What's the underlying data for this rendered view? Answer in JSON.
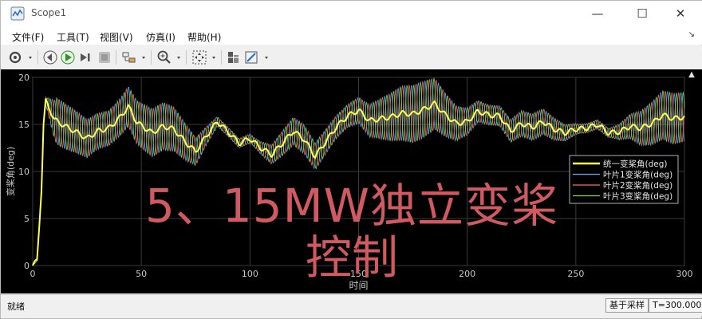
{
  "window": {
    "title": "Scope1"
  },
  "menu": [
    "文件(F)",
    "工具(T)",
    "视图(V)",
    "仿真(I)",
    "帮助(H)"
  ],
  "toolbar_icons": [
    "settings-icon",
    "step-back-icon",
    "run-icon",
    "step-forward-icon",
    "stop-icon",
    "highlight-block-icon",
    "zoom-icon",
    "fit-to-view-icon",
    "cursor-measure-icon",
    "style-edit-icon"
  ],
  "status": {
    "left": "就绪",
    "mode": "基于采样",
    "time": "T=300.000"
  },
  "overlay": {
    "line1": "5、15MW独立变桨",
    "line2": "控制"
  },
  "colors": {
    "plot_bg": "#000000",
    "unified": "#ffff55",
    "blade1": "#5aa8ff",
    "blade2": "#ff6f55",
    "blade3": "#7fdc5a",
    "overlay": "#d05a5f"
  },
  "chart_data": {
    "type": "line",
    "xlabel": "时间",
    "ylabel": "变桨角(deg)",
    "xlim": [
      0,
      300
    ],
    "ylim": [
      0,
      20
    ],
    "xticks": [
      0,
      50,
      100,
      150,
      200,
      250,
      300
    ],
    "yticks": [
      0,
      5,
      10,
      15,
      20
    ],
    "grid": true,
    "legend_position": "right",
    "series": [
      {
        "name": "统一变桨角(deg)",
        "key": "unified"
      },
      {
        "name": "叶片1变桨角(deg)",
        "key": "blade1"
      },
      {
        "name": "叶片2变桨角(deg)",
        "key": "blade2"
      },
      {
        "name": "叶片3变桨角(deg)",
        "key": "blade3"
      }
    ],
    "unified_x": [
      0,
      2,
      4,
      5,
      6,
      10,
      15,
      20,
      25,
      30,
      35,
      40,
      44,
      48,
      55,
      60,
      65,
      70,
      75,
      80,
      85,
      90,
      95,
      100,
      105,
      110,
      115,
      120,
      125,
      130,
      135,
      140,
      145,
      150,
      155,
      160,
      165,
      170,
      175,
      180,
      185,
      190,
      195,
      200,
      205,
      210,
      215,
      220,
      225,
      230,
      235,
      240,
      245,
      250,
      255,
      260,
      265,
      270,
      275,
      280,
      285,
      290,
      295,
      300
    ],
    "unified_y": [
      0,
      0.5,
      8,
      15,
      17.5,
      15.5,
      14.8,
      14.2,
      13.5,
      14.3,
      14.6,
      15.7,
      16.9,
      15.2,
      14.1,
      14.8,
      14.5,
      13.2,
      12.1,
      13.8,
      15.3,
      14.2,
      13.0,
      13.5,
      12.5,
      11.8,
      13.0,
      14.3,
      13.4,
      11.6,
      13.2,
      14.8,
      15.9,
      16.5,
      15.4,
      15.6,
      15.8,
      16.2,
      16.1,
      16.6,
      17.2,
      16.0,
      15.1,
      15.3,
      16.4,
      16.0,
      15.9,
      14.3,
      15.1,
      14.7,
      15.3,
      14.5,
      14.1,
      14.5,
      14.6,
      15.0,
      14.1,
      14.2,
      14.8,
      14.6,
      15.1,
      16.0,
      15.6,
      15.8
    ]
  }
}
